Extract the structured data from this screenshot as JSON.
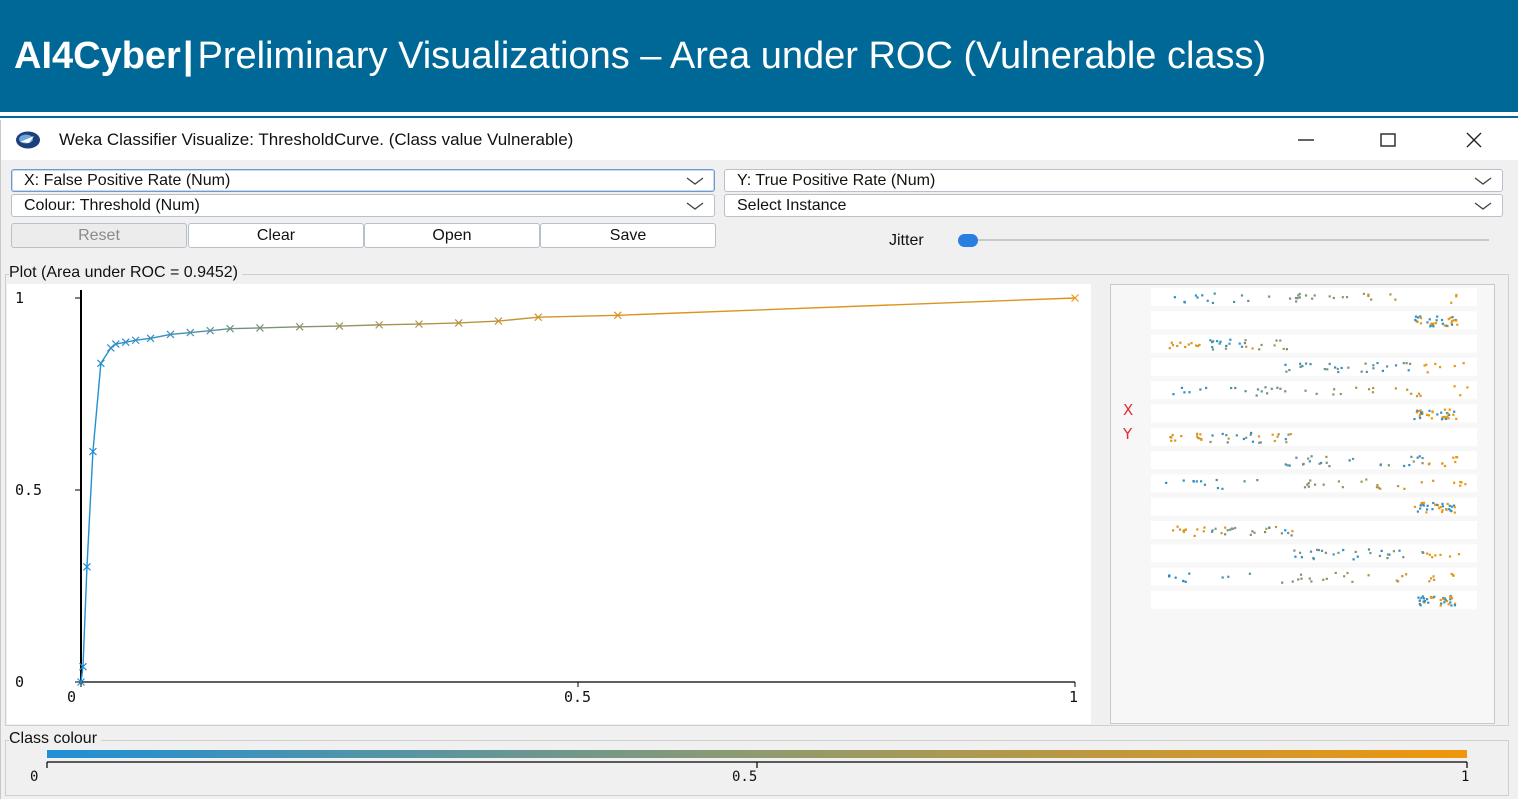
{
  "slide": {
    "brand": "AI4Cyber",
    "separator": "|",
    "title": "Preliminary Visualizations – Area under ROC (Vulnerable class)",
    "header_color": "#006896"
  },
  "window": {
    "title": "Weka Classifier Visualize: ThresholdCurve. (Class value Vulnerable)",
    "icon": "weka-bird-icon",
    "controls": {
      "minimize": "—",
      "maximize": "☐",
      "close": "✕"
    }
  },
  "axes_selectors": {
    "x": "X: False Positive Rate (Num)",
    "y": "Y: True Positive Rate (Num)",
    "colour": "Colour: Threshold (Num)",
    "instance": "Select Instance"
  },
  "buttons": {
    "reset": "Reset",
    "clear": "Clear",
    "open": "Open",
    "save": "Save"
  },
  "jitter": {
    "label": "Jitter",
    "value": 0
  },
  "plot": {
    "legend": "Plot (Area under ROC = 0.9452)",
    "area_under_roc": 0.9452
  },
  "matrix": {
    "x_marker": "X",
    "y_marker": "Y",
    "rows": 14
  },
  "class_colour": {
    "legend": "Class colour",
    "min": "0",
    "mid": "0.5",
    "max": "1",
    "low_color": "#1f8fd6",
    "high_color": "#f0960a"
  },
  "chart_data": {
    "type": "line",
    "title": "",
    "xlabel": "",
    "ylabel": "",
    "xlim": [
      0,
      1
    ],
    "ylim": [
      0,
      1
    ],
    "x_ticks": [
      "0",
      "0.5",
      "1"
    ],
    "y_ticks": [
      "0",
      "0.5",
      "1"
    ],
    "grid": false,
    "marker": "x",
    "series": [
      {
        "points": [
          {
            "x": 0.0,
            "y": 0.0,
            "t": 1.0
          },
          {
            "x": 0.002,
            "y": 0.04,
            "t": 0.99
          },
          {
            "x": 0.006,
            "y": 0.3,
            "t": 0.985
          },
          {
            "x": 0.012,
            "y": 0.6,
            "t": 0.98
          },
          {
            "x": 0.02,
            "y": 0.83,
            "t": 0.97
          },
          {
            "x": 0.03,
            "y": 0.87,
            "t": 0.96
          },
          {
            "x": 0.035,
            "y": 0.88,
            "t": 0.95
          },
          {
            "x": 0.045,
            "y": 0.885,
            "t": 0.93
          },
          {
            "x": 0.055,
            "y": 0.89,
            "t": 0.91
          },
          {
            "x": 0.07,
            "y": 0.895,
            "t": 0.88
          },
          {
            "x": 0.09,
            "y": 0.905,
            "t": 0.83
          },
          {
            "x": 0.11,
            "y": 0.91,
            "t": 0.77
          },
          {
            "x": 0.13,
            "y": 0.915,
            "t": 0.7
          },
          {
            "x": 0.15,
            "y": 0.92,
            "t": 0.62
          },
          {
            "x": 0.18,
            "y": 0.922,
            "t": 0.55
          },
          {
            "x": 0.22,
            "y": 0.925,
            "t": 0.48
          },
          {
            "x": 0.26,
            "y": 0.927,
            "t": 0.42
          },
          {
            "x": 0.3,
            "y": 0.93,
            "t": 0.36
          },
          {
            "x": 0.34,
            "y": 0.932,
            "t": 0.31
          },
          {
            "x": 0.38,
            "y": 0.935,
            "t": 0.26
          },
          {
            "x": 0.42,
            "y": 0.94,
            "t": 0.2
          },
          {
            "x": 0.46,
            "y": 0.95,
            "t": 0.15
          },
          {
            "x": 0.54,
            "y": 0.955,
            "t": 0.1
          },
          {
            "x": 1.0,
            "y": 1.0,
            "t": 0.0
          }
        ]
      }
    ]
  }
}
